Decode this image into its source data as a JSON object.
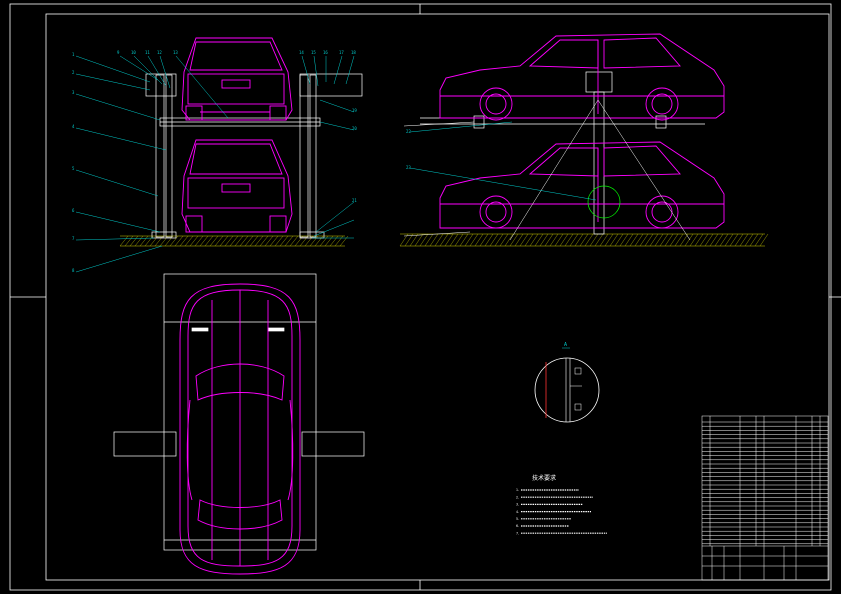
{
  "drawing": {
    "colors": {
      "background": "#000000",
      "frame": "#ffffff",
      "car": "#ff00ff",
      "leader": "#00cccc",
      "section": "#ff3333",
      "ground": "#cccc00",
      "detail": "#00ff00"
    },
    "front_view_labels": [
      "1",
      "2",
      "3",
      "4",
      "5",
      "6",
      "7",
      "8",
      "9",
      "10",
      "11",
      "12",
      "13",
      "14",
      "15",
      "16",
      "17",
      "18",
      "19",
      "20",
      "21"
    ],
    "side_view_labels": [
      "22",
      "23"
    ],
    "detail_mark": "A",
    "notes_title": "技术要求",
    "notes": [
      "1. ",
      "2. ",
      "3. ",
      "4. ",
      "5. ",
      "6. ",
      "7. "
    ]
  }
}
